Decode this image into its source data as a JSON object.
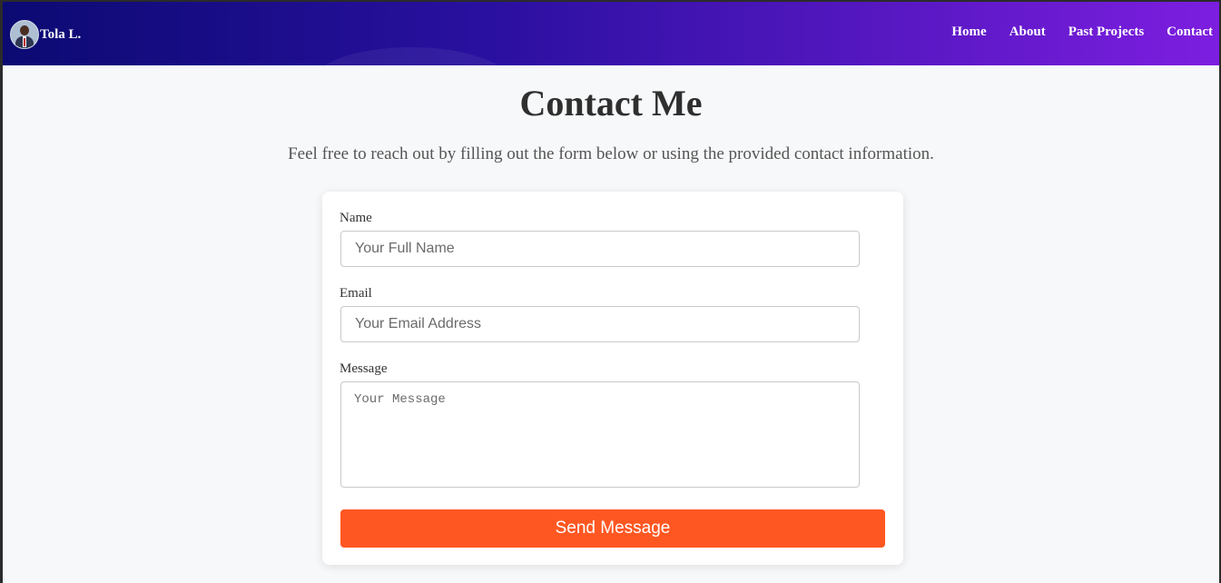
{
  "header": {
    "brand_name": "Tola L.",
    "nav": {
      "home": "Home",
      "about": "About",
      "past_projects": "Past Projects",
      "contact": "Contact"
    }
  },
  "main": {
    "title": "Contact Me",
    "subtitle": "Feel free to reach out by filling out the form below or using the provided contact information."
  },
  "form": {
    "name_label": "Name",
    "name_placeholder": "Your Full Name",
    "email_label": "Email",
    "email_placeholder": "Your Email Address",
    "message_label": "Message",
    "message_placeholder": "Your Message",
    "submit_label": "Send Message"
  },
  "colors": {
    "header_gradient_start": "#0b0a72",
    "header_gradient_end": "#7d1ee0",
    "button": "#ff5722",
    "background": "#f7f8fa"
  }
}
